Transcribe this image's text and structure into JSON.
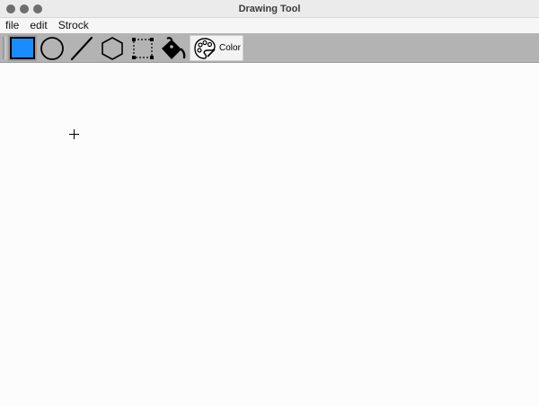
{
  "window": {
    "title": "Drawing Tool"
  },
  "menubar": {
    "items": [
      {
        "label": "file"
      },
      {
        "label": "edit"
      },
      {
        "label": "Strock"
      }
    ]
  },
  "toolbar": {
    "tools": [
      {
        "icon": "rectangle-icon",
        "selected": true
      },
      {
        "icon": "ellipse-icon",
        "selected": false
      },
      {
        "icon": "line-icon",
        "selected": false
      },
      {
        "icon": "polygon-icon",
        "selected": false
      },
      {
        "icon": "selection-icon",
        "selected": false
      },
      {
        "icon": "paint-bucket-icon",
        "selected": false
      }
    ],
    "color_button": {
      "icon": "palette-icon",
      "label": "Color"
    }
  },
  "colors": {
    "rectangle_fill": "#1a8cff",
    "canvas_background": "#fdfcfd",
    "toolbar_background": "#b3b3b3"
  },
  "cursor": {
    "icon": "crosshair-cursor-icon"
  }
}
